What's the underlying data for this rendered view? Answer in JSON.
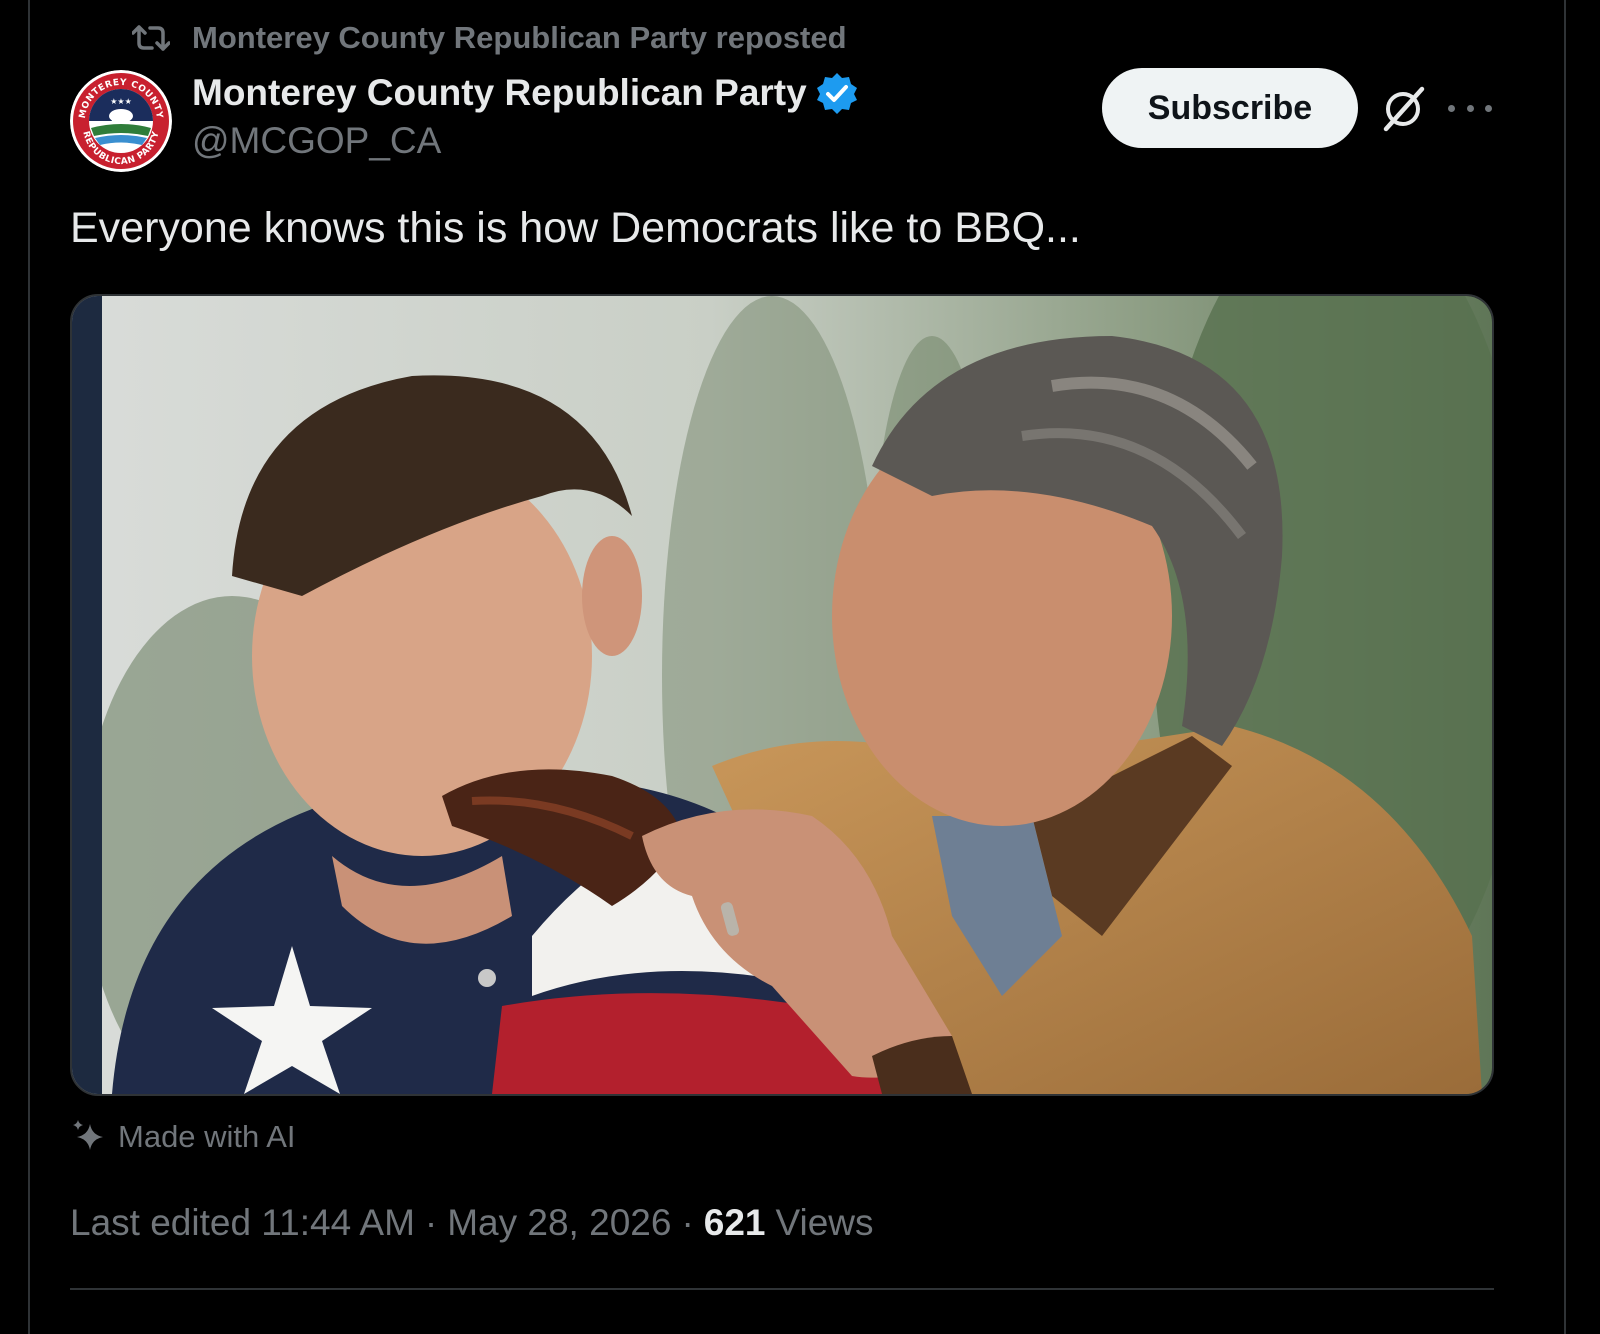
{
  "repost": {
    "icon": "repost-icon",
    "text": "Monterey County Republican Party reposted"
  },
  "author": {
    "display_name": "Monterey County Republican Party",
    "handle": "@MCGOP_CA",
    "verified_icon": "verified-badge-icon",
    "verified_color": "#1d9bf0",
    "avatar": {
      "ring_top_text": "MONTEREY COUNTY",
      "ring_bottom_text": "REPUBLICAN PARTY",
      "ring_color": "#c8202f",
      "emblem_color": "#1b2d5c"
    }
  },
  "actions": {
    "subscribe_label": "Subscribe",
    "grok_icon": "grok-icon",
    "more_icon": "more-options-icon"
  },
  "post": {
    "text": "Everyone knows this is how Democrats like to BBQ..."
  },
  "media": {
    "label": "AI-generated photo: man in Texas-flag shirt eating a rib held by a grey-haired man in a tan jacket"
  },
  "ai_label": {
    "icon": "sparkle-icon",
    "text": "Made with AI"
  },
  "meta": {
    "edited": "Last edited 11:44 AM",
    "separator": "·",
    "date": "May 28, 2026",
    "views_count": "621",
    "views_label": "Views"
  },
  "colors": {
    "background": "#000000",
    "primary_text": "#e7e9ea",
    "secondary_text": "#71767b",
    "border": "#2f3336",
    "subscribe_bg": "#eff3f4"
  }
}
